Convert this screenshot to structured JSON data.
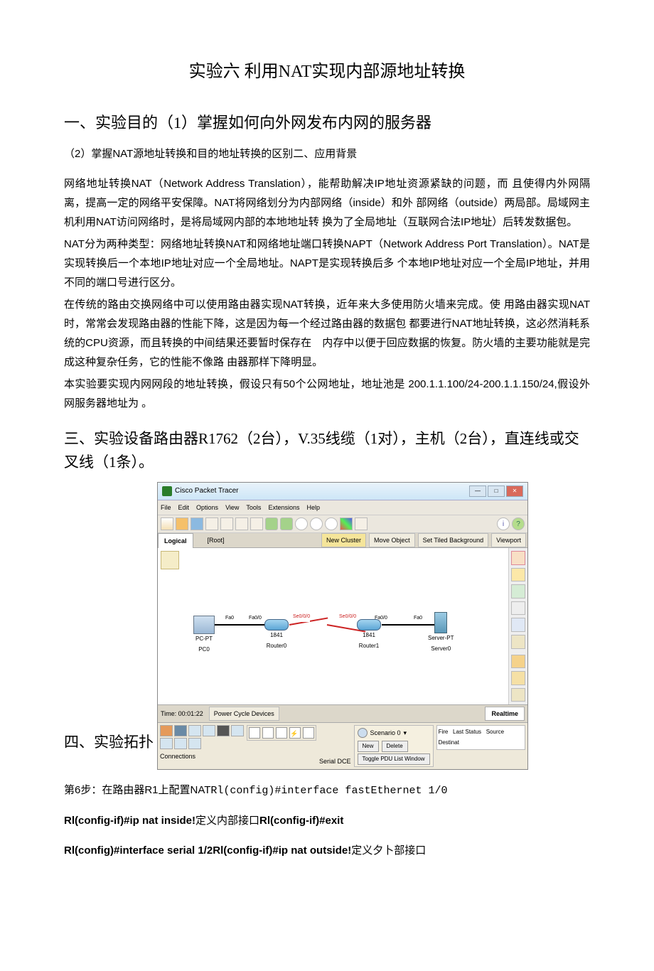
{
  "title": "实验六 利用NAT实现内部源地址转换",
  "section1": {
    "heading": "一、实验目的（1）掌握如何向外网发布内网的服务器",
    "sub": "（2）掌握NAT源地址转换和目的地址转换的区别二、应用背景"
  },
  "paragraphs": {
    "p1": "网络地址转换NAT（Network Address Translation），能帮助解决IP地址资源紧缺的问题，而 且使得内外网隔离，提高一定的网络平安保障。NAT将网络划分为内部网络（inside）和外 部网络（outside）两局部。局域网主机利用NAT访问网络时，是将局域网内部的本地地址转 换为了全局地址（互联网合法IP地址）后转发数据包。",
    "p2": "NAT分为两种类型：网络地址转换NAT和网络地址端口转换NAPT（Network Address Port Translation）。NAT是实现转换后一个本地IP地址对应一个全局地址。NAPT是实现转换后多 个本地IP地址对应一个全局IP地址，并用不同的端口号进行区分。",
    "p3": "在传统的路由交换网络中可以使用路由器实现NAT转换，近年来大多使用防火墙来完成。使 用路由器实现NAT时，常常会发现路由器的性能下降，这是因为每一个经过路由器的数据包 都要进行NAT地址转换，这必然消耗系统的CPU资源，而且转换的中间结果还要暂时保存在　内存中以便于回应数据的恢复。防火墙的主要功能就是完成这种复杂任务，它的性能不像路 由器那样下降明显。",
    "p4": "本实验要实现内网网段的地址转换，假设只有50个公网地址，地址池是 200.1.1.100/24-200.1.1.150/24,假设外网服务器地址为 。"
  },
  "section3": "三、实验设备路由器R1762（2台），V.35线缆（1对），主机（2台），直连线或交叉线（1条）。",
  "section4_label": "四、实验拓扑",
  "screenshot": {
    "title": "Cisco Packet Tracer",
    "menu": [
      "File",
      "Edit",
      "Options",
      "View",
      "Tools",
      "Extensions",
      "Help"
    ],
    "subbar": {
      "tab": "Logical",
      "root": "[Root]",
      "new_cluster": "New Cluster",
      "move_obj": "Move Object",
      "set_bg": "Set Tiled Background",
      "viewport": "Viewport"
    },
    "devices": {
      "pc0": {
        "label1": "PC-PT",
        "label2": "PC0"
      },
      "r0": {
        "label1": "1841",
        "label2": "Router0"
      },
      "r1": {
        "label1": "1841",
        "label2": "Router1"
      },
      "srv": {
        "label1": "Server-PT",
        "label2": "Server0"
      }
    },
    "ports": {
      "pc_fa": "Fa0",
      "r0_fa": "Fa0/0",
      "r0_se": "Se0/0/0",
      "r1_se": "Se0/0/0",
      "r1_fa": "Fa0/0",
      "srv_fa": "Fa0"
    },
    "timebar": {
      "time": "Time: 00:01:22",
      "pcd": "Power Cycle Devices",
      "realtime": "Realtime"
    },
    "bottom": {
      "connections": "Connections",
      "serial_dce": "Serial DCE",
      "scenario": "Scenario 0",
      "new": "New",
      "delete": "Delete",
      "toggle": "Toggle PDU List Window",
      "fire": "Fire",
      "last": "Last Status",
      "source": "Source",
      "dest": "Destinat"
    }
  },
  "step6": {
    "line1_a": "第6步：在路由器R1上配置NAT",
    "line1_b": "Rl(config)#interface fastEthernet 1/0",
    "line2_a": "Rl(config-if)#ip nat inside!",
    "line2_b": "定义内部接口",
    "line2_c": "Rl(config-if)#exit",
    "line3_a": "Rl(config)#interface serial 1/2Rl(config-if)#ip nat outside!",
    "line3_b": "定义夕卜部接口"
  }
}
